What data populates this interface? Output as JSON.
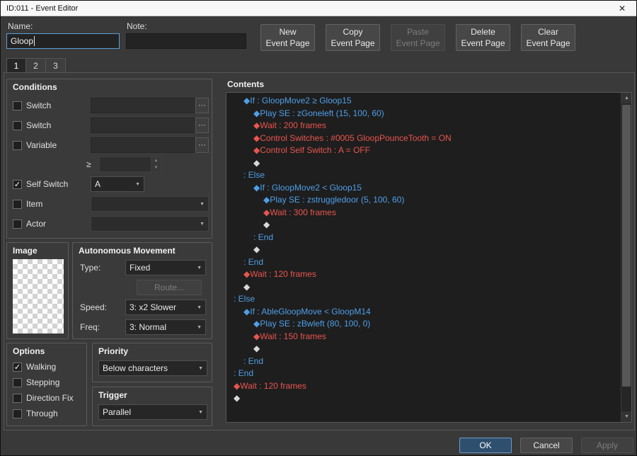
{
  "window": {
    "title": "ID:011 - Event Editor"
  },
  "glyphs": {
    "check": "✓",
    "close": "✕",
    "ellipsis": "···",
    "combo_arrow": "▼",
    "spin_up": "▲",
    "spin_down": "▼",
    "scroll_up": "▲",
    "scroll_down": "▼"
  },
  "colors": {
    "accent_focus": "#5a9fd4",
    "ok_button_bg": "#2e4f6d",
    "command_blue": "#4f9fe8",
    "command_red": "#e8554f",
    "command_plain": "#d8d8d8"
  },
  "header": {
    "name_label": "Name:",
    "name_value": "Gloop",
    "note_label": "Note:",
    "note_value": "",
    "page_buttons": [
      {
        "label": "New\nEvent Page",
        "enabled": true
      },
      {
        "label": "Copy\nEvent Page",
        "enabled": true
      },
      {
        "label": "Paste\nEvent Page",
        "enabled": false
      },
      {
        "label": "Delete\nEvent Page",
        "enabled": true
      },
      {
        "label": "Clear\nEvent Page",
        "enabled": true
      }
    ]
  },
  "tabs": [
    {
      "label": "1",
      "active": true
    },
    {
      "label": "2",
      "active": false
    },
    {
      "label": "3",
      "active": false
    }
  ],
  "conditions": {
    "title": "Conditions",
    "switch1": {
      "label": "Switch",
      "checked": false,
      "value": ""
    },
    "switch2": {
      "label": "Switch",
      "checked": false,
      "value": ""
    },
    "variable": {
      "label": "Variable",
      "checked": false,
      "value": ""
    },
    "gte": "≥",
    "variable_amount": "",
    "self_switch": {
      "label": "Self Switch",
      "checked": true,
      "value": "A"
    },
    "item": {
      "label": "Item",
      "checked": false,
      "value": ""
    },
    "actor": {
      "label": "Actor",
      "checked": false,
      "value": ""
    }
  },
  "image": {
    "title": "Image"
  },
  "movement": {
    "title": "Autonomous Movement",
    "type_label": "Type:",
    "type_value": "Fixed",
    "route_label": "Route...",
    "speed_label": "Speed:",
    "speed_value": "3: x2 Slower",
    "freq_label": "Freq:",
    "freq_value": "3: Normal"
  },
  "options": {
    "title": "Options",
    "items": [
      {
        "label": "Walking",
        "checked": true
      },
      {
        "label": "Stepping",
        "checked": false
      },
      {
        "label": "Direction Fix",
        "checked": false
      },
      {
        "label": "Through",
        "checked": false
      }
    ]
  },
  "priority": {
    "title": "Priority",
    "value": "Below characters"
  },
  "trigger": {
    "title": "Trigger",
    "value": "Parallel"
  },
  "contents": {
    "title": "Contents",
    "lines": [
      {
        "indent": 1,
        "color": "blue",
        "text": "◆If : GloopMove2 ≥ Gloop15"
      },
      {
        "indent": 2,
        "color": "blue",
        "text": "◆Play SE : zGoneleft (15, 100, 60)"
      },
      {
        "indent": 2,
        "color": "red",
        "text": "◆Wait : 200 frames"
      },
      {
        "indent": 2,
        "color": "red",
        "text": "◆Control Switches : #0005 GloopPounceTooth = ON"
      },
      {
        "indent": 2,
        "color": "red",
        "text": "◆Control Self Switch : A = OFF"
      },
      {
        "indent": 2,
        "color": "plain",
        "text": "◆"
      },
      {
        "indent": 1,
        "color": "blue",
        "text": ": Else"
      },
      {
        "indent": 2,
        "color": "blue",
        "text": "◆If : GloopMove2 < Gloop15"
      },
      {
        "indent": 3,
        "color": "blue",
        "text": "◆Play SE : zstruggledoor (5, 100, 60)"
      },
      {
        "indent": 3,
        "color": "red",
        "text": "◆Wait : 300 frames"
      },
      {
        "indent": 3,
        "color": "plain",
        "text": "◆"
      },
      {
        "indent": 2,
        "color": "blue",
        "text": ": End"
      },
      {
        "indent": 2,
        "color": "plain",
        "text": "◆"
      },
      {
        "indent": 1,
        "color": "blue",
        "text": ": End"
      },
      {
        "indent": 1,
        "color": "red",
        "text": "◆Wait : 120 frames"
      },
      {
        "indent": 1,
        "color": "plain",
        "text": "◆"
      },
      {
        "indent": 0,
        "color": "blue",
        "text": ": Else"
      },
      {
        "indent": 1,
        "color": "blue",
        "text": "◆If : AbleGloopMove < GloopM14"
      },
      {
        "indent": 2,
        "color": "blue",
        "text": "◆Play SE : zBwleft (80, 100, 0)"
      },
      {
        "indent": 2,
        "color": "red",
        "text": "◆Wait : 150 frames"
      },
      {
        "indent": 2,
        "color": "plain",
        "text": "◆"
      },
      {
        "indent": 1,
        "color": "blue",
        "text": ": End"
      },
      {
        "indent": 0,
        "color": "blue",
        "text": ": End"
      },
      {
        "indent": 0,
        "color": "red",
        "text": "◆Wait : 120 frames"
      },
      {
        "indent": 0,
        "color": "plain",
        "text": "◆"
      }
    ]
  },
  "footer": {
    "ok": "OK",
    "cancel": "Cancel",
    "apply": "Apply"
  }
}
